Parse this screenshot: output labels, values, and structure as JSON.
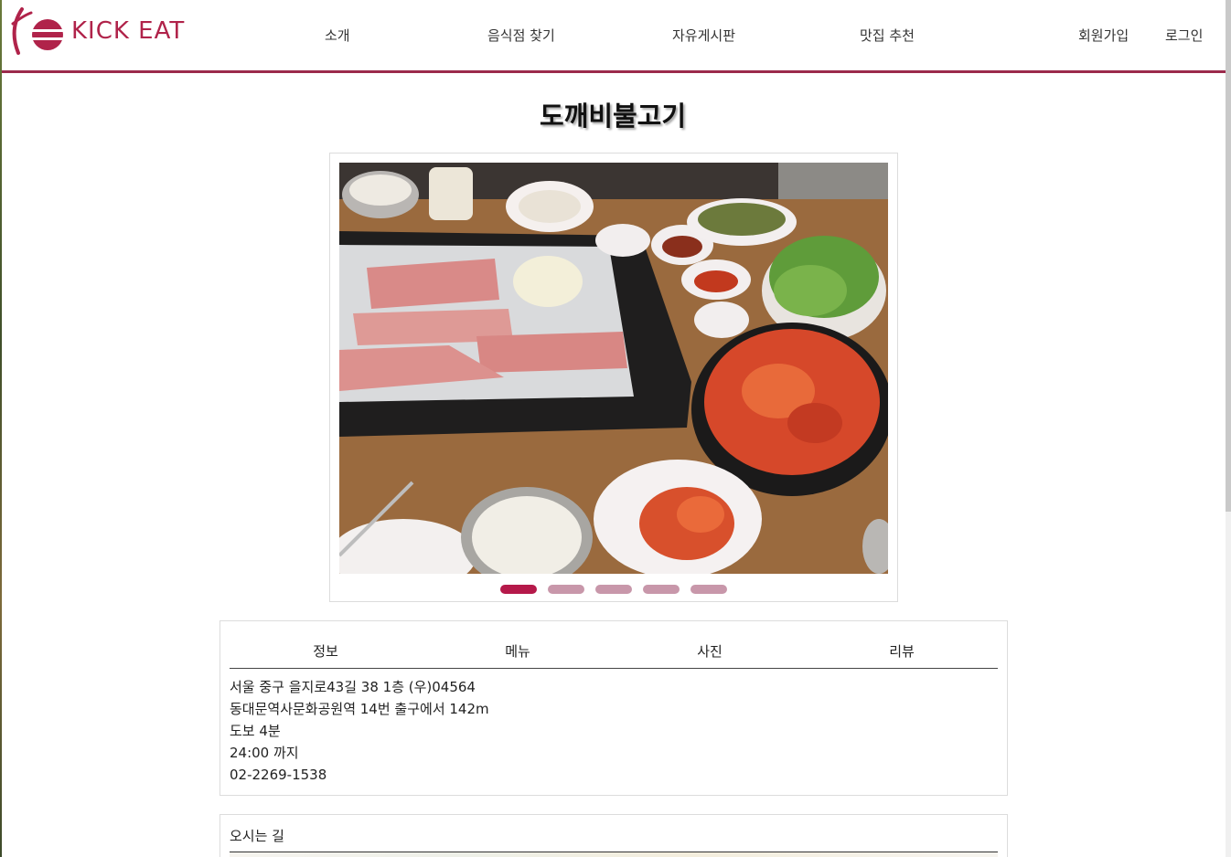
{
  "brand": {
    "name": "KICK EAT",
    "color": "#b0234a"
  },
  "nav": {
    "items": [
      "소개",
      "음식점 찾기",
      "자유게시판",
      "맛집 추천"
    ],
    "signup": "회원가입",
    "login": "로그인"
  },
  "restaurant": {
    "name": "도깨비불고기"
  },
  "carousel": {
    "slide_count": 5,
    "active_index": 0,
    "active_color": "#b5194a",
    "inactive_color": "#c897aa"
  },
  "tabs": [
    "정보",
    "메뉴",
    "사진",
    "리뷰"
  ],
  "info": {
    "address": "서울 중구 을지로43길 38 1층 (우)04564",
    "station": "동대문역사문화공원역 14번 출구에서 142m",
    "walk": "도보 4분",
    "hours": "24:00 까지",
    "phone": "02-2269-1538"
  },
  "directions": {
    "title": "오시는 길"
  }
}
